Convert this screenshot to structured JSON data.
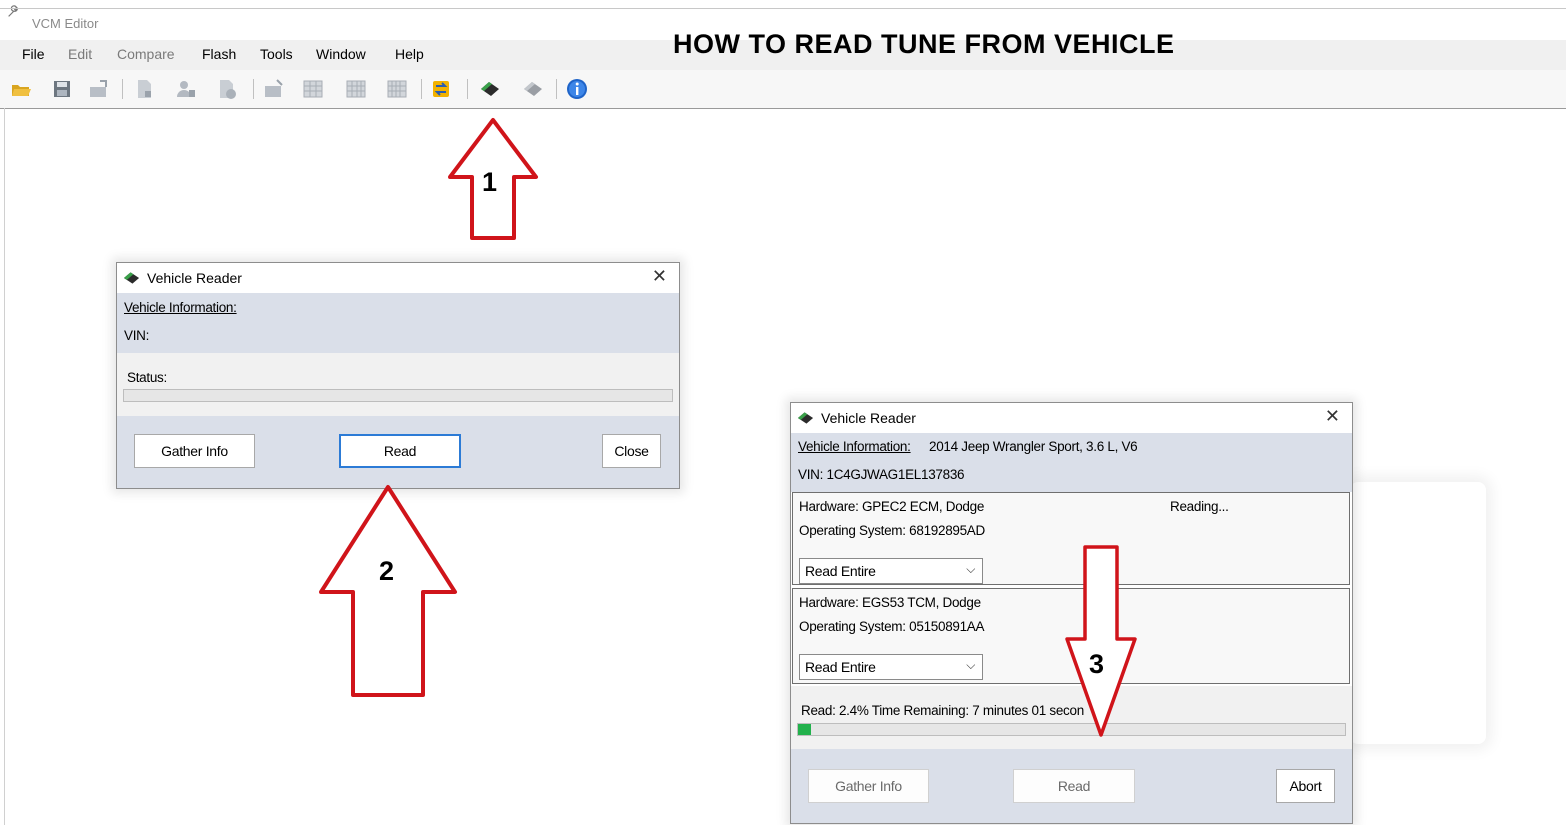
{
  "window": {
    "title": "VCM Editor"
  },
  "headline": "HOW TO READ TUNE FROM VEHICLE",
  "menu": [
    "File",
    "Edit",
    "Compare",
    "Flash",
    "Tools",
    "Window",
    "Help"
  ],
  "toolbar_icons": [
    "open-folder-icon",
    "save-icon",
    "export-icon",
    "document-icon",
    "users-icon",
    "document-clock-icon",
    "import-icon",
    "table-icon",
    "table-grid-icon",
    "table-compare-icon",
    "switch-icon",
    "read-vehicle-icon",
    "write-vehicle-icon",
    "info-icon"
  ],
  "arrows": {
    "one": "1",
    "two": "2",
    "three": "3"
  },
  "dialog1": {
    "title": "Vehicle Reader",
    "vehicle_info_label": "Vehicle Information:",
    "vin_label": "VIN:",
    "status_label": "Status:",
    "progress": 0,
    "gather_label": "Gather Info",
    "read_label": "Read",
    "close_label": "Close"
  },
  "dialog2": {
    "title": "Vehicle Reader",
    "vehicle_info_label": "Vehicle Information:",
    "vehicle_info_value": "2014 Jeep Wrangler Sport, 3.6 L, V6",
    "vin_text": "VIN: 1C4GJWAG1EL137836",
    "modules": [
      {
        "hardware": "Hardware: GPEC2 ECM, Dodge",
        "os": "Operating System: 68192895AD",
        "mode": "Read Entire",
        "status": "Reading..."
      },
      {
        "hardware": "Hardware: EGS53 TCM, Dodge",
        "os": "Operating System: 05150891AA",
        "mode": "Read Entire",
        "status": ""
      }
    ],
    "progress_text": "Read: 2.4% Time Remaining: 7 minutes 01 secon",
    "progress": 0.024,
    "gather_label": "Gather Info",
    "read_label": "Read",
    "abort_label": "Abort"
  },
  "colors": {
    "arrow": "#d0141a",
    "progress_fill": "#22b14c",
    "panel": "#dadfe9"
  }
}
